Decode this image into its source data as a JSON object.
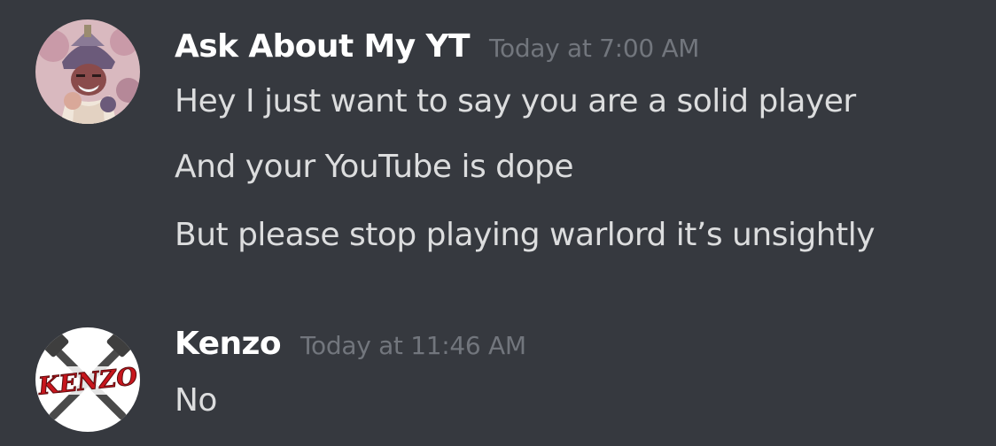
{
  "messages": [
    {
      "username": "Ask About My YT",
      "timestamp": "Today at 7:00 AM",
      "avatar_icon": "samurai-avatar-icon",
      "lines": [
        "Hey I just want to say you are a solid player",
        "And your YouTube is dope",
        "But please stop playing warlord it’s unsightly"
      ]
    },
    {
      "username": "Kenzo",
      "timestamp": "Today at 11:46 AM",
      "avatar_icon": "kenzo-logo-avatar-icon",
      "avatar_logo_text": "KENZO",
      "lines": [
        "No"
      ]
    }
  ],
  "colors": {
    "background": "#36393f",
    "username": "#ffffff",
    "timestamp": "#72767d",
    "message_text": "#dcddde",
    "logo_red": "#c8161d"
  }
}
